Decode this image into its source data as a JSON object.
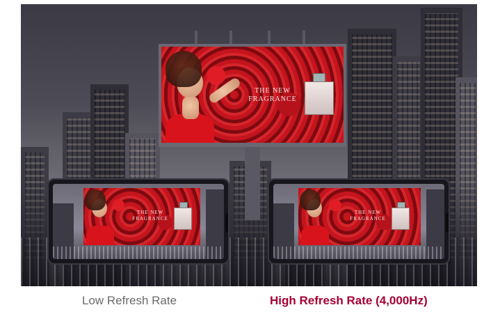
{
  "figure": {
    "billboard_ad": {
      "line1": "THE NEW",
      "line2": "FRAGRANCE"
    },
    "phone_ad": {
      "line1": "THE NEW",
      "line2": "FRAGRANCE"
    }
  },
  "captions": {
    "left": "Low Refresh Rate",
    "right": "High Refresh Rate (4,000Hz)"
  },
  "colors": {
    "left_caption": "#6b6b6b",
    "right_caption": "#a50034"
  }
}
